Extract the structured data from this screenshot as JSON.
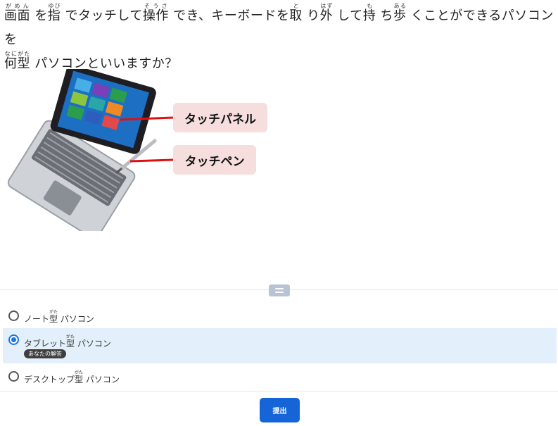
{
  "question": {
    "parts": [
      {
        "base": "画面",
        "ruby": "がめん"
      },
      {
        "text": " を"
      },
      {
        "base": "指",
        "ruby": "ゆび"
      },
      {
        "text": " でタッチして"
      },
      {
        "base": "操作",
        "ruby": "そうさ"
      },
      {
        "text": " でき、キーボードを"
      },
      {
        "base": "取",
        "ruby": "と"
      },
      {
        "text": " り"
      },
      {
        "base": "外",
        "ruby": "はず"
      },
      {
        "text": " して"
      },
      {
        "base": "持",
        "ruby": "も"
      },
      {
        "text": " ち"
      },
      {
        "base": "歩",
        "ruby": "ある"
      },
      {
        "text": " くことができるパソコンを"
      },
      {
        "base": "何型",
        "ruby": "なにがた"
      },
      {
        "text": " パソコンといいますか？"
      }
    ]
  },
  "figure": {
    "callout_panel": "タッチパネル",
    "callout_pen": "タッチペン",
    "colors": {
      "callout_bg": "#f6dede",
      "leader_line": "#e01010"
    }
  },
  "options": [
    {
      "pre": "ノート",
      "base": "型",
      "ruby": "がた",
      "post": " パソコン",
      "selected": false
    },
    {
      "pre": "タブレット",
      "base": "型",
      "ruby": "がた",
      "post": " パソコン",
      "selected": true,
      "badge": "あなたの解答"
    },
    {
      "pre": "デスクトップ",
      "base": "型",
      "ruby": "がた",
      "post": " パソコン",
      "selected": false
    }
  ],
  "submit_label": "提出",
  "colors": {
    "accent": "#1565d8",
    "selected_bg": "#e3f0fb"
  }
}
